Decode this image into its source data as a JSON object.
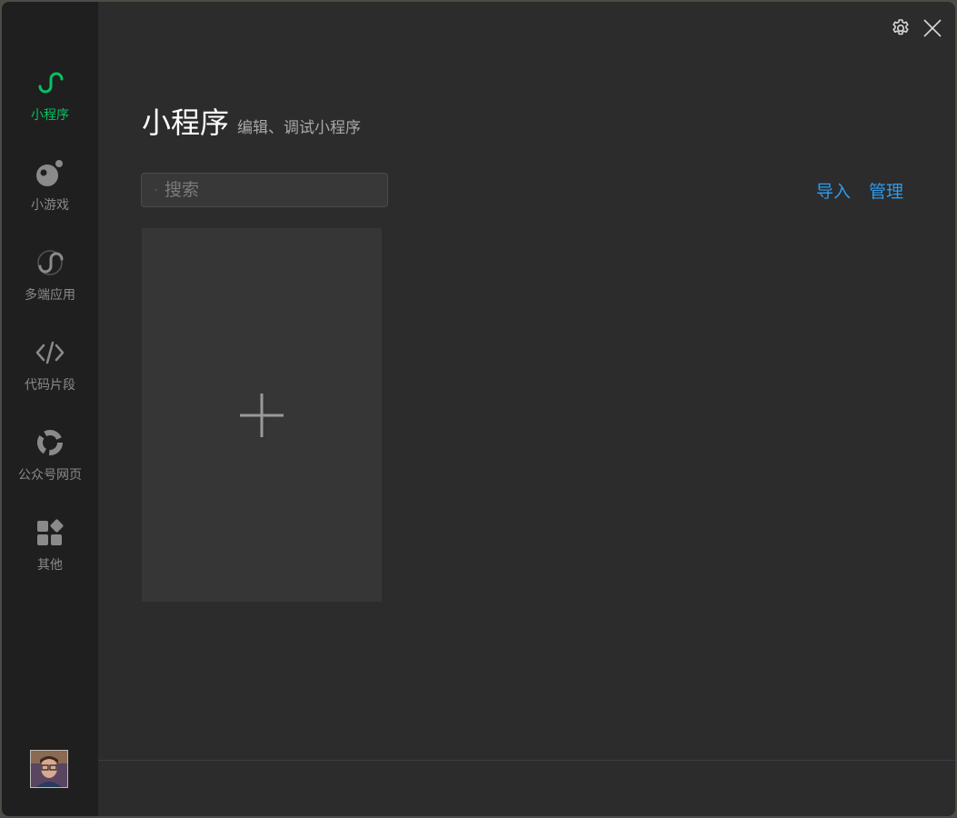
{
  "window": {
    "accent_color": "#07c160",
    "link_color": "#2b9cee"
  },
  "sidebar": {
    "items": [
      {
        "label": "小程序",
        "icon": "mini-program-icon",
        "active": true
      },
      {
        "label": "小游戏",
        "icon": "mini-game-icon",
        "active": false
      },
      {
        "label": "多端应用",
        "icon": "multi-platform-icon",
        "active": false
      },
      {
        "label": "代码片段",
        "icon": "code-snippet-icon",
        "active": false
      },
      {
        "label": "公众号网页",
        "icon": "official-account-web-icon",
        "active": false
      },
      {
        "label": "其他",
        "icon": "other-apps-icon",
        "active": false
      }
    ],
    "avatar": "user-avatar"
  },
  "header": {
    "settings_icon": "gear-icon",
    "close_icon": "close-icon"
  },
  "main": {
    "title": "小程序",
    "subtitle": "编辑、调试小程序",
    "search": {
      "placeholder": "搜索",
      "value": ""
    },
    "actions": {
      "import": "导入",
      "manage": "管理"
    },
    "add_card_icon": "plus-icon"
  }
}
